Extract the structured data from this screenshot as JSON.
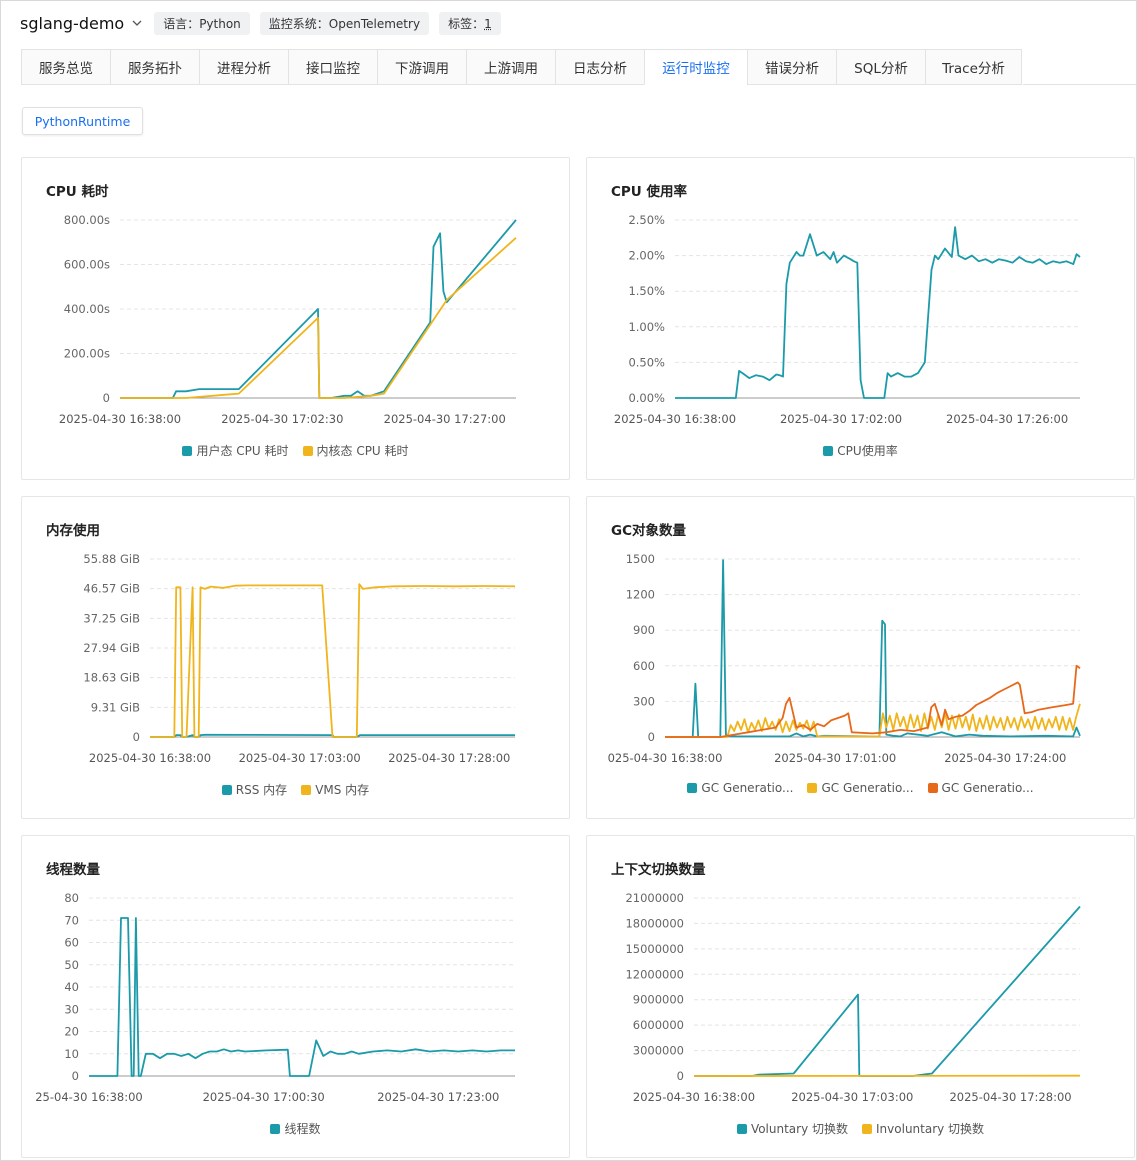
{
  "header": {
    "app_title": "sglang-demo",
    "tags": [
      {
        "label": "语言：Python"
      },
      {
        "label": "监控系统：OpenTelemetry"
      },
      {
        "label_prefix": "标签：",
        "label_value": "1"
      }
    ]
  },
  "tabs": [
    {
      "label": "服务总览",
      "active": false
    },
    {
      "label": "服务拓扑",
      "active": false
    },
    {
      "label": "进程分析",
      "active": false
    },
    {
      "label": "接口监控",
      "active": false
    },
    {
      "label": "下游调用",
      "active": false
    },
    {
      "label": "上游调用",
      "active": false
    },
    {
      "label": "日志分析",
      "active": false
    },
    {
      "label": "运行时监控",
      "active": true
    },
    {
      "label": "错误分析",
      "active": false
    },
    {
      "label": "SQL分析",
      "active": false
    },
    {
      "label": "Trace分析",
      "active": false
    }
  ],
  "subtab": {
    "label": "PythonRuntime"
  },
  "colors": {
    "teal": "#1b9aaa",
    "yellow": "#f0b51c",
    "orange": "#e8681a",
    "active_tab": "#1a6ff0"
  },
  "chart_data": [
    {
      "id": "cpu-time",
      "type": "line",
      "title": "CPU 耗时",
      "yticks": [
        "0",
        "200.00s",
        "400.00s",
        "600.00s",
        "800.00s"
      ],
      "ylim": [
        0,
        800
      ],
      "xticks": [
        "2025-04-30 16:38:00",
        "2025-04-30 17:02:30",
        "2025-04-30 17:27:00"
      ],
      "xlim": [
        0,
        60
      ],
      "series": [
        {
          "name": "用户态 CPU 耗时",
          "color": "#1b9aaa",
          "x": [
            0,
            8,
            8.5,
            10,
            12,
            14,
            16,
            18,
            30,
            30.2,
            32,
            34,
            35,
            36,
            37,
            38,
            40,
            47,
            47.5,
            48.5,
            49,
            49.5,
            60
          ],
          "y": [
            0,
            0,
            30,
            30,
            40,
            40,
            40,
            40,
            400,
            0,
            0,
            10,
            10,
            30,
            10,
            10,
            30,
            340,
            680,
            740,
            480,
            430,
            800
          ]
        },
        {
          "name": "内核态 CPU 耗时",
          "color": "#f0b51c",
          "x": [
            0,
            10,
            12,
            14,
            16,
            18,
            30,
            30.2,
            34,
            38,
            40,
            49.5,
            60
          ],
          "y": [
            0,
            0,
            5,
            10,
            15,
            20,
            360,
            0,
            0,
            10,
            20,
            440,
            720
          ]
        }
      ]
    },
    {
      "id": "cpu-usage",
      "type": "line",
      "title": "CPU 使用率",
      "yticks": [
        "0.00%",
        "0.50%",
        "1.00%",
        "1.50%",
        "2.00%",
        "2.50%"
      ],
      "ylim": [
        0,
        2.5
      ],
      "xticks": [
        "2025-04-30 16:38:00",
        "2025-04-30 17:02:00",
        "2025-04-30 17:26:00"
      ],
      "xlim": [
        0,
        60
      ],
      "series": [
        {
          "name": "CPU使用率",
          "color": "#1b9aaa",
          "x": [
            0,
            9,
            9.5,
            10,
            11,
            12,
            13,
            14,
            15,
            15.5,
            16,
            16.5,
            17,
            18,
            18.5,
            19,
            20,
            21,
            22,
            23,
            23.5,
            24,
            25,
            26,
            26.5,
            27,
            27.5,
            28,
            30,
            31,
            31.5,
            32,
            33,
            34,
            35,
            36,
            37,
            38,
            38.5,
            39,
            40,
            41,
            41.5,
            42,
            43,
            44,
            45,
            46,
            47,
            48,
            49,
            50,
            51,
            52,
            53,
            54,
            55,
            56,
            57,
            58,
            59,
            59.5,
            60
          ],
          "y": [
            0,
            0,
            0.38,
            0.35,
            0.28,
            0.32,
            0.3,
            0.25,
            0.33,
            0.32,
            0.3,
            1.6,
            1.9,
            2.05,
            2,
            2.0,
            2.3,
            2.0,
            2.05,
            1.95,
            2.05,
            1.9,
            2.0,
            1.95,
            1.92,
            1.9,
            0.25,
            0,
            0,
            0,
            0.35,
            0.3,
            0.35,
            0.3,
            0.3,
            0.35,
            0.5,
            1.8,
            2.0,
            1.95,
            2.1,
            1.98,
            2.4,
            2.0,
            1.95,
            2.0,
            1.92,
            1.95,
            1.9,
            1.95,
            1.93,
            1.9,
            1.98,
            1.92,
            1.9,
            1.95,
            1.88,
            1.92,
            1.9,
            1.92,
            1.88,
            2.02,
            1.98
          ]
        }
      ]
    },
    {
      "id": "memory",
      "type": "line",
      "title": "内存使用",
      "yticks": [
        "0",
        "9.31 GiB",
        "18.63 GiB",
        "27.94 GiB",
        "37.25 GiB",
        "46.57 GiB",
        "55.88 GiB"
      ],
      "ylim": [
        0,
        55.88
      ],
      "xticks": [
        "2025-04-30 16:38:00",
        "2025-04-30 17:03:00",
        "2025-04-30 17:28:00"
      ],
      "xlim": [
        0,
        60
      ],
      "series": [
        {
          "name": "RSS 内存",
          "color": "#1b9aaa",
          "x": [
            0,
            4,
            4.3,
            5,
            5.3,
            6,
            7,
            7.3,
            8,
            8.3,
            9,
            10,
            30,
            30.2,
            34,
            34.5,
            60
          ],
          "y": [
            0,
            0,
            0.6,
            0.6,
            0,
            0,
            0.6,
            0,
            0,
            0.6,
            0.7,
            0.7,
            0.6,
            0,
            0,
            0.6,
            0.6
          ]
        },
        {
          "name": "VMS 内存",
          "color": "#f0b51c",
          "x": [
            0,
            4,
            4.3,
            5,
            5.3,
            6,
            7,
            7.3,
            8,
            8.3,
            9,
            10,
            12,
            14,
            16,
            18,
            20,
            25,
            28,
            28.3,
            30,
            30.3,
            34,
            34.4,
            35,
            37,
            40,
            45,
            50,
            55,
            60
          ],
          "y": [
            0,
            0,
            47,
            47,
            0,
            0,
            47,
            0,
            0,
            47,
            46.5,
            47.2,
            46.8,
            47.5,
            47.6,
            47.6,
            47.6,
            47.6,
            47.6,
            47.6,
            0,
            0,
            0,
            48,
            46.5,
            47,
            47.3,
            47.4,
            47.3,
            47.4,
            47.3
          ]
        }
      ]
    },
    {
      "id": "gc",
      "type": "line",
      "title": "GC对象数量",
      "yticks": [
        "0",
        "300",
        "600",
        "900",
        "1200",
        "1500"
      ],
      "ylim": [
        0,
        1500
      ],
      "xticks": [
        "025-04-30 16:38:00",
        "2025-04-30 17:01:00",
        "2025-04-30 17:24:00"
      ],
      "xlim": [
        0,
        60
      ],
      "series": [
        {
          "name": "GC Generatio...",
          "color": "#1b9aaa",
          "x": [
            0,
            4,
            4.4,
            4.8,
            5,
            8,
            8.4,
            8.8,
            9,
            10,
            18,
            19,
            20,
            21,
            22,
            23,
            30,
            31,
            31.4,
            31.8,
            32,
            33,
            34,
            35,
            38,
            40,
            42,
            44,
            46,
            50,
            55,
            59,
            59.5,
            60
          ],
          "y": [
            0,
            0,
            450,
            0,
            0,
            0,
            1490,
            20,
            10,
            5,
            5,
            30,
            5,
            20,
            5,
            10,
            5,
            5,
            980,
            950,
            20,
            10,
            5,
            30,
            10,
            40,
            5,
            20,
            10,
            5,
            10,
            5,
            80,
            10
          ]
        },
        {
          "name": "GC Generatio...",
          "color": "#f0b51c",
          "x": [
            0,
            9,
            9.5,
            10,
            10.5,
            11,
            11.5,
            12,
            12.5,
            13,
            13.5,
            14,
            14.5,
            15,
            15.5,
            16,
            16.5,
            17,
            17.5,
            18,
            18.5,
            19,
            19.5,
            20,
            20.5,
            21,
            21.5,
            22,
            30,
            31,
            31.5,
            32,
            32.5,
            33,
            33.5,
            34,
            34.5,
            35,
            35.5,
            36,
            36.5,
            37,
            37.5,
            38,
            38.5,
            39,
            39.5,
            40,
            40.5,
            41,
            41.5,
            42,
            42.5,
            43,
            43.5,
            44,
            44.5,
            45,
            45.5,
            46,
            46.5,
            47,
            47.5,
            48,
            48.5,
            49,
            49.5,
            50,
            50.5,
            51,
            51.5,
            52,
            52.5,
            53,
            53.5,
            54,
            54.5,
            55,
            55.5,
            56,
            56.5,
            57,
            57.5,
            58,
            58.5,
            59,
            59.5,
            60
          ],
          "y": [
            0,
            0,
            100,
            50,
            130,
            60,
            150,
            40,
            120,
            60,
            140,
            50,
            160,
            70,
            130,
            60,
            150,
            40,
            130,
            50,
            140,
            60,
            120,
            70,
            140,
            50,
            130,
            5,
            5,
            5,
            200,
            80,
            180,
            60,
            200,
            90,
            170,
            60,
            190,
            80,
            180,
            50,
            200,
            70,
            170,
            60,
            190,
            80,
            200,
            60,
            180,
            70,
            190,
            80,
            170,
            60,
            190,
            50,
            160,
            70,
            180,
            60,
            170,
            80,
            160,
            60,
            170,
            80,
            160,
            60,
            170,
            80,
            150,
            60,
            170,
            70,
            160,
            60,
            150,
            80,
            170,
            60,
            170,
            60,
            160,
            60,
            180,
            280
          ]
        },
        {
          "name": "GC Generatio...",
          "color": "#e8681a",
          "x": [
            0,
            8,
            10,
            12,
            14,
            16,
            17,
            17.5,
            18,
            19,
            20,
            21,
            22,
            23,
            24,
            25,
            26,
            26.5,
            27,
            30,
            32,
            34,
            36,
            38,
            38.5,
            39,
            40,
            40.5,
            41,
            42,
            43,
            44,
            45,
            46,
            47,
            48,
            49,
            50,
            51,
            51.3,
            52,
            53,
            54,
            55,
            56,
            57,
            58,
            59,
            59.5,
            60
          ],
          "y": [
            0,
            0,
            20,
            40,
            60,
            80,
            160,
            280,
            330,
            80,
            100,
            60,
            110,
            90,
            140,
            160,
            180,
            200,
            40,
            30,
            40,
            60,
            50,
            80,
            250,
            280,
            100,
            230,
            150,
            170,
            180,
            220,
            270,
            300,
            330,
            370,
            400,
            430,
            460,
            440,
            200,
            210,
            230,
            240,
            250,
            260,
            270,
            280,
            600,
            580
          ]
        }
      ]
    },
    {
      "id": "threads",
      "type": "line",
      "title": "线程数量",
      "yticks": [
        "0",
        "10",
        "20",
        "30",
        "40",
        "50",
        "60",
        "70",
        "80"
      ],
      "ylim": [
        0,
        80
      ],
      "xticks": [
        "25-04-30 16:38:00",
        "2025-04-30 17:00:30",
        "2025-04-30 17:23:00"
      ],
      "xlim": [
        0,
        60
      ],
      "series": [
        {
          "name": "线程数",
          "color": "#1b9aaa",
          "x": [
            0,
            4,
            4.5,
            5.5,
            6,
            6.3,
            6.6,
            7,
            7.3,
            8,
            9,
            10,
            11,
            12,
            13,
            14,
            15,
            16,
            17,
            18,
            19,
            20,
            21,
            22,
            25,
            28,
            28.3,
            31,
            32,
            33,
            34,
            35,
            36,
            37,
            38,
            40,
            42,
            44,
            46,
            48,
            50,
            52,
            54,
            56,
            58,
            60
          ],
          "y": [
            0,
            0,
            71,
            71,
            0,
            0,
            71,
            0,
            0,
            10,
            10,
            8,
            10,
            10,
            9,
            10,
            8,
            10,
            11,
            11,
            12,
            11,
            11.5,
            11,
            11.5,
            11.8,
            0,
            0,
            16,
            9,
            11,
            10,
            10,
            11,
            10,
            11,
            11.5,
            11,
            12,
            11,
            11.5,
            11,
            11.5,
            11,
            11.5,
            11.5
          ]
        }
      ]
    },
    {
      "id": "ctx-switch",
      "type": "line",
      "title": "上下文切换数量",
      "yticks": [
        "0",
        "3000000",
        "6000000",
        "9000000",
        "12000000",
        "15000000",
        "18000000",
        "21000000"
      ],
      "ylim": [
        0,
        21000000
      ],
      "xticks": [
        "2025-04-30 16:38:00",
        "2025-04-30 17:03:00",
        "2025-04-30 17:28:00"
      ],
      "xlim": [
        0,
        60
      ],
      "series": [
        {
          "name": "Voluntary 切换数",
          "color": "#1b9aaa",
          "x": [
            0,
            9,
            10,
            15.5,
            25.5,
            25.7,
            34,
            36,
            37,
            60
          ],
          "y": [
            0,
            0,
            150000,
            300000,
            9600000,
            0,
            0,
            200000,
            300000,
            20000000
          ]
        },
        {
          "name": "Involuntary 切换数",
          "color": "#f0b51c",
          "x": [
            0,
            60
          ],
          "y": [
            0,
            40000
          ]
        }
      ]
    }
  ]
}
